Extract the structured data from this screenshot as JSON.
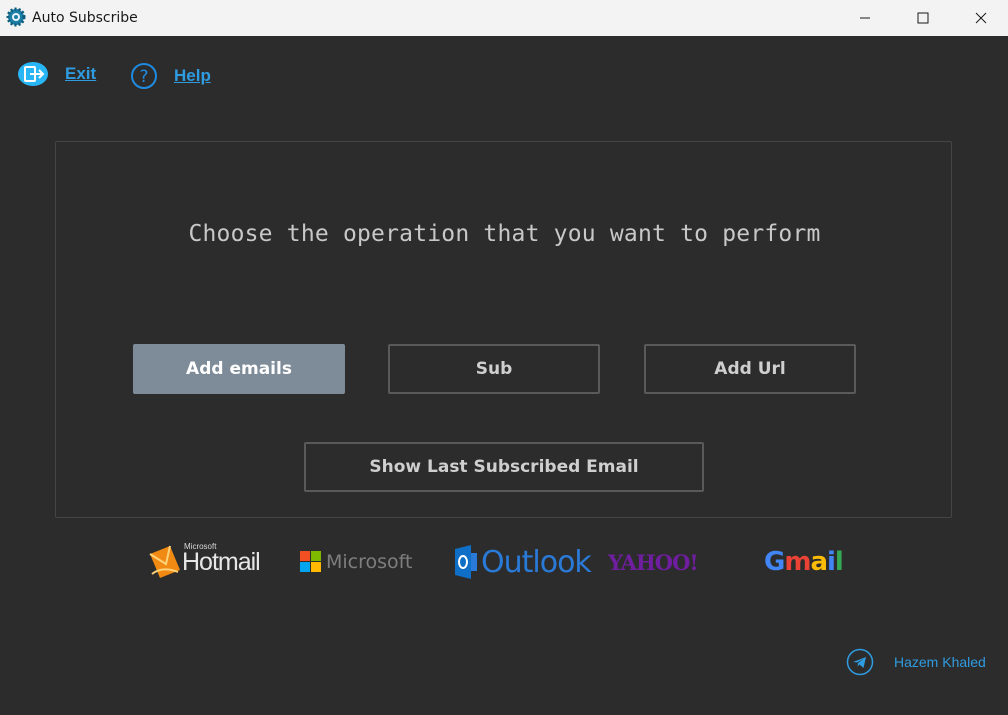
{
  "window": {
    "title": "Auto Subscribe"
  },
  "toolbar": {
    "exit_label": "Exit",
    "help_label": "Help"
  },
  "main": {
    "heading": "Choose the operation that you want to perform",
    "buttons": {
      "add_emails": "Add emails",
      "sub": "Sub",
      "add_url": "Add Url",
      "show_last": "Show Last Subscribed Email"
    }
  },
  "logos": {
    "hotmail_small": "Microsoft",
    "hotmail": "Hotmail",
    "microsoft": "Microsoft",
    "outlook": "Outlook",
    "yahoo": "YAHOO!",
    "gmail": [
      "G",
      "m",
      "a",
      "i",
      "l"
    ]
  },
  "footer": {
    "author": "Hazem Khaled"
  },
  "colors": {
    "accent": "#2f9be0",
    "primary_button": "#7e8b98",
    "background": "#2c2c2c"
  },
  "icons": [
    "app-gear-icon",
    "exit-icon",
    "help-icon",
    "telegram-icon"
  ]
}
